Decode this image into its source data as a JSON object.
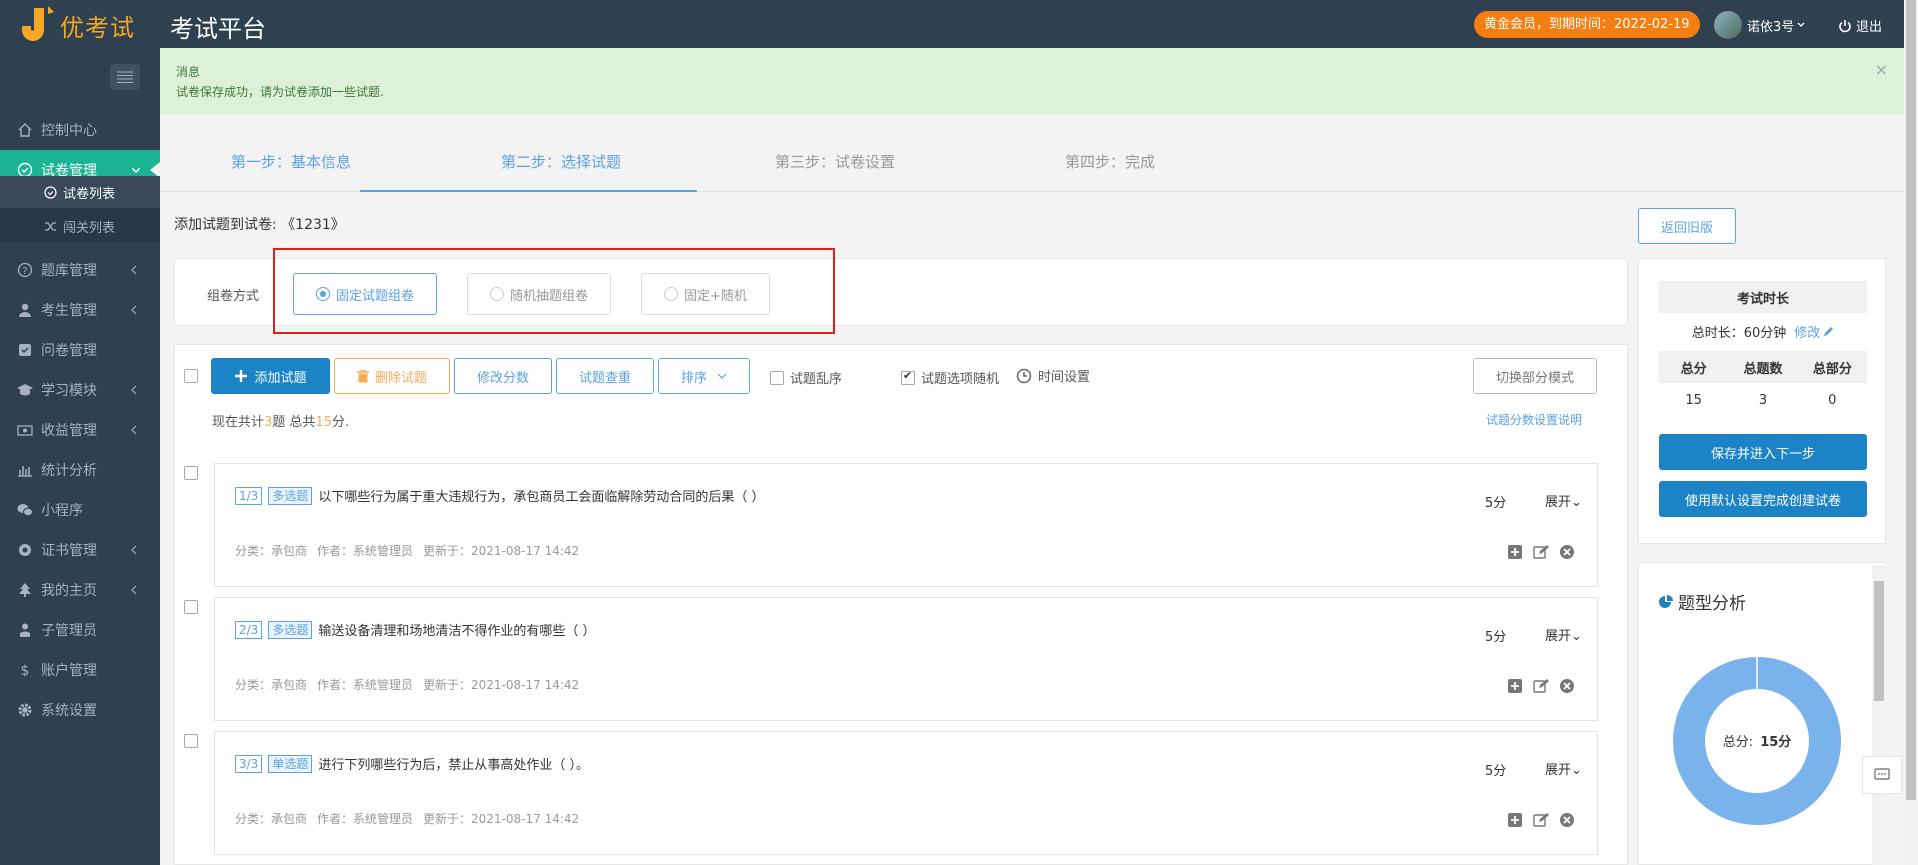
{
  "header": {
    "logo_text": "优考试",
    "app_title": "考试平台",
    "vip_badge": "黄金会员，到期时间：2022-02-19",
    "user_name": "诺依3号",
    "logout": "退出"
  },
  "sidebar": {
    "items": [
      {
        "label": "控制中心",
        "icon": "home-icon"
      },
      {
        "label": "试卷管理",
        "icon": "check-circle-icon"
      },
      {
        "label": "题库管理",
        "icon": "question-circle-icon"
      },
      {
        "label": "考生管理",
        "icon": "user-icon"
      },
      {
        "label": "问卷管理",
        "icon": "check-square-icon"
      },
      {
        "label": "学习模块",
        "icon": "graduation-cap-icon"
      },
      {
        "label": "收益管理",
        "icon": "money-icon"
      },
      {
        "label": "统计分析",
        "icon": "bar-chart-icon"
      },
      {
        "label": "小程序",
        "icon": "wechat-icon"
      },
      {
        "label": "证书管理",
        "icon": "certificate-icon"
      },
      {
        "label": "我的主页",
        "icon": "tree-icon"
      },
      {
        "label": "子管理员",
        "icon": "user-tie-icon"
      },
      {
        "label": "账户管理",
        "icon": "dollar-icon"
      },
      {
        "label": "系统设置",
        "icon": "gear-icon"
      }
    ],
    "submenu": [
      {
        "label": "试卷列表"
      },
      {
        "label": "闯关列表"
      }
    ]
  },
  "alert": {
    "title": "消息",
    "message": "试卷保存成功，请为试卷添加一些试题.",
    "close": "×"
  },
  "steps": [
    {
      "label": "第一步：基本信息"
    },
    {
      "label": "第二步：选择试题"
    },
    {
      "label": "第三步：试卷设置"
    },
    {
      "label": "第四步：完成"
    }
  ],
  "page": {
    "add_title": "添加试题到试卷: 《1231》",
    "return_btn": "返回旧版"
  },
  "compose": {
    "label": "组卷方式",
    "options": [
      {
        "label": "固定试题组卷"
      },
      {
        "label": "随机抽题组卷"
      },
      {
        "label": "固定+随机"
      }
    ]
  },
  "toolbar": {
    "add": "添加试题",
    "delete": "删除试题",
    "edit_score": "修改分数",
    "dedupe": "试题查重",
    "sort": "排序",
    "shuffle": "试题乱序",
    "option_random": "试题选项随机",
    "time_setting": "时间设置",
    "switch_mode": "切换部分模式"
  },
  "summary": {
    "prefix": "现在共计",
    "count": "3",
    "mid": "题 总共",
    "total": "15",
    "suffix": "分.",
    "help_link": "试题分数设置说明"
  },
  "questions": [
    {
      "num": "1/3",
      "type": "多选题",
      "text": "以下哪些行为属于重大违规行为，承包商员工会面临解除劳动合同的后果（ ）",
      "score": "5分",
      "expand": "展开",
      "category": "分类：承包商",
      "author": "作者：系统管理员",
      "updated": "更新于：2021-08-17 14:42"
    },
    {
      "num": "2/3",
      "type": "多选题",
      "text": "输送设备清理和场地清洁不得作业的有哪些（ ）",
      "score": "5分",
      "expand": "展开",
      "category": "分类：承包商",
      "author": "作者：系统管理员",
      "updated": "更新于：2021-08-17 14:42"
    },
    {
      "num": "3/3",
      "type": "单选题",
      "text": "进行下列哪些行为后，禁止从事高处作业（ ）。",
      "score": "5分",
      "expand": "展开",
      "category": "分类：承包商",
      "author": "作者：系统管理员",
      "updated": "更新于：2021-08-17 14:42"
    }
  ],
  "exam_panel": {
    "duration_title": "考试时长",
    "duration_label": "总时长：60分钟",
    "edit": "修改",
    "stats_headers": [
      "总分",
      "总题数",
      "总部分"
    ],
    "stats_values": [
      "15",
      "3",
      "0"
    ],
    "save_next": "保存并进入下一步",
    "default_create": "使用默认设置完成创建试卷"
  },
  "analysis": {
    "title": "题型分析",
    "center_label": "总分:",
    "center_value": "15分",
    "slice_color": "#7ab3eb",
    "slice_fraction": 1.0
  }
}
